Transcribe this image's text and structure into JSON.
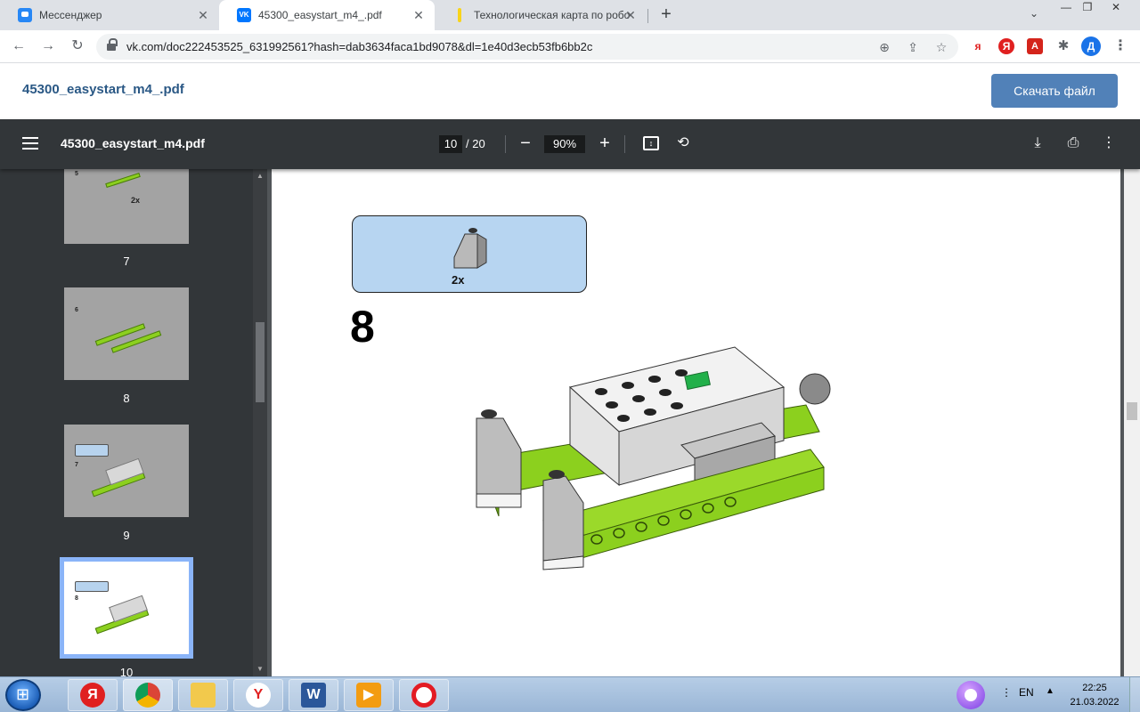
{
  "browser": {
    "tabs": [
      {
        "title": "Мессенджер",
        "close": "✕"
      },
      {
        "title": "45300_easystart_m4_.pdf",
        "close": "✕"
      },
      {
        "title": "Технологическая карта по робо",
        "close": "✕"
      }
    ],
    "new_tab": "+",
    "url": "vk.com/doc222453525_631992561?hash=dab3634faca1bd9078&dl=1e40d3ecb53fb6bb2c",
    "extensions": {
      "ya1": "я",
      "ya2": "Я",
      "pdf": "A",
      "avatar": "Д"
    }
  },
  "vk": {
    "doc_title": "45300_easystart_m4_.pdf",
    "download_label": "Скачать файл"
  },
  "pdf": {
    "file_name": "45300_easystart_m4.pdf",
    "current_page": "10",
    "total_pages": "/ 20",
    "zoom": "90%",
    "zoom_out": "−",
    "zoom_in": "+"
  },
  "thumbnails": [
    {
      "page": "7",
      "step": "5",
      "qty": "2x"
    },
    {
      "page": "8",
      "step": "6"
    },
    {
      "page": "9",
      "step": "7"
    },
    {
      "page": "10",
      "step": "8"
    }
  ],
  "page_content": {
    "parts_qty": "2x",
    "step_number": "8"
  },
  "taskbar": {
    "lang": "EN",
    "time": "22:25",
    "date": "21.03.2022"
  },
  "colors": {
    "lego_green": "#8cd01e",
    "parts_box": "#b7d5f1",
    "pdf_toolbar": "#323639",
    "vk_blue": "#5181b8"
  }
}
